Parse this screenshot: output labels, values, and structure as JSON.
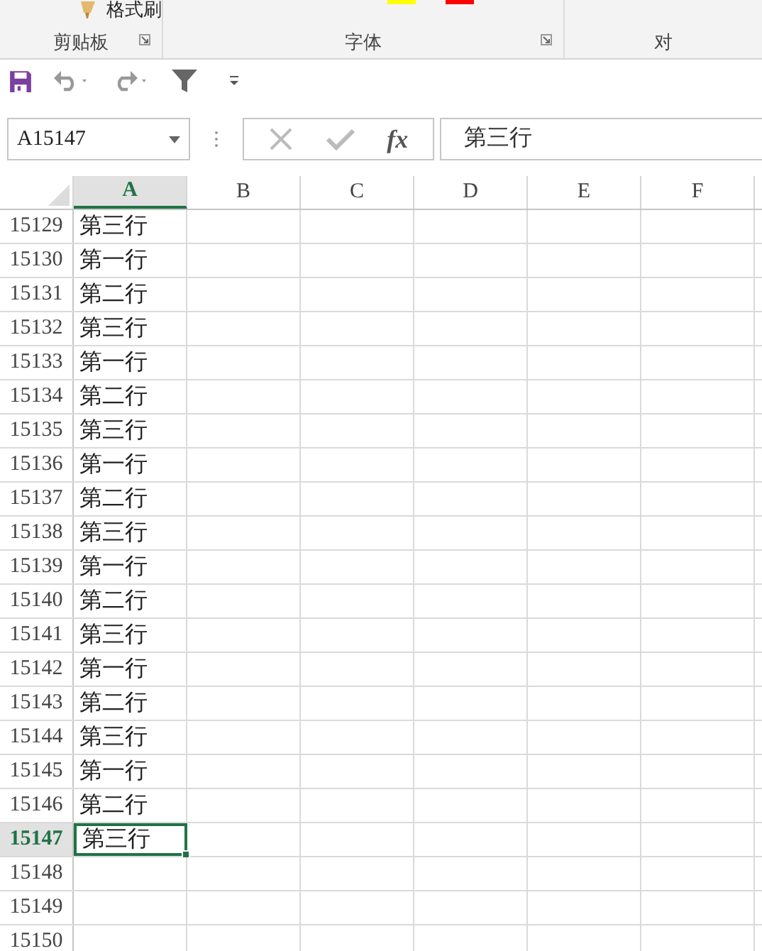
{
  "ribbon": {
    "top_button": "格式刷",
    "groups": [
      {
        "label": "剪贴板",
        "launcher": true
      },
      {
        "label": "字体",
        "launcher": true
      },
      {
        "label": "对",
        "launcher": false
      }
    ]
  },
  "name_box": {
    "value": "A15147"
  },
  "formula_bar": {
    "function_label": "fx",
    "value": "第三行"
  },
  "columns": [
    {
      "label": "A",
      "selected": true
    },
    {
      "label": "B",
      "selected": false
    },
    {
      "label": "C",
      "selected": false
    },
    {
      "label": "D",
      "selected": false
    },
    {
      "label": "E",
      "selected": false
    },
    {
      "label": "F",
      "selected": false
    }
  ],
  "rows": [
    {
      "header": "15129",
      "cells": [
        "第三行"
      ],
      "selected": false
    },
    {
      "header": "15130",
      "cells": [
        "第一行"
      ],
      "selected": false
    },
    {
      "header": "15131",
      "cells": [
        "第二行"
      ],
      "selected": false
    },
    {
      "header": "15132",
      "cells": [
        "第三行"
      ],
      "selected": false
    },
    {
      "header": "15133",
      "cells": [
        "第一行"
      ],
      "selected": false
    },
    {
      "header": "15134",
      "cells": [
        "第二行"
      ],
      "selected": false
    },
    {
      "header": "15135",
      "cells": [
        "第三行"
      ],
      "selected": false
    },
    {
      "header": "15136",
      "cells": [
        "第一行"
      ],
      "selected": false
    },
    {
      "header": "15137",
      "cells": [
        "第二行"
      ],
      "selected": false
    },
    {
      "header": "15138",
      "cells": [
        "第三行"
      ],
      "selected": false
    },
    {
      "header": "15139",
      "cells": [
        "第一行"
      ],
      "selected": false
    },
    {
      "header": "15140",
      "cells": [
        "第二行"
      ],
      "selected": false
    },
    {
      "header": "15141",
      "cells": [
        "第三行"
      ],
      "selected": false
    },
    {
      "header": "15142",
      "cells": [
        "第一行"
      ],
      "selected": false
    },
    {
      "header": "15143",
      "cells": [
        "第二行"
      ],
      "selected": false
    },
    {
      "header": "15144",
      "cells": [
        "第三行"
      ],
      "selected": false
    },
    {
      "header": "15145",
      "cells": [
        "第一行"
      ],
      "selected": false
    },
    {
      "header": "15146",
      "cells": [
        "第二行"
      ],
      "selected": false
    },
    {
      "header": "15147",
      "cells": [
        "第三行"
      ],
      "selected": true
    },
    {
      "header": "15148",
      "cells": [],
      "selected": false
    },
    {
      "header": "15149",
      "cells": [],
      "selected": false
    },
    {
      "header": "15150",
      "cells": [],
      "selected": false
    }
  ]
}
